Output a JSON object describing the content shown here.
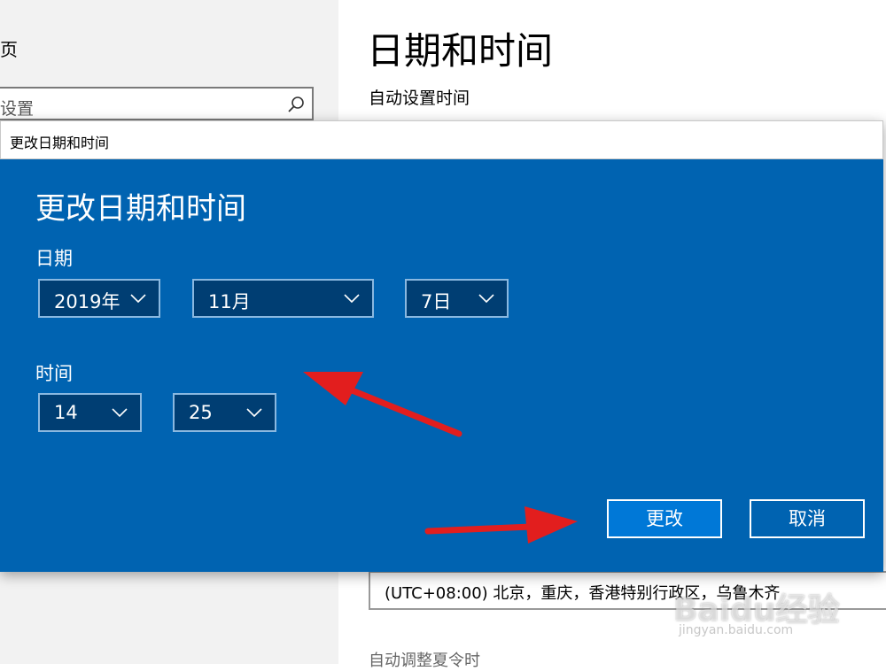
{
  "left": {
    "home_label": "主页",
    "search_placeholder": "查找设置"
  },
  "right": {
    "title": "日期和时间",
    "auto_time_label": "自动设置时间",
    "timezone_value": "(UTC+08:00) 北京，重庆，香港特别行政区，乌鲁木齐",
    "dst_label": "自动调整夏令时"
  },
  "dialog": {
    "window_title": "更改日期和时间",
    "heading": "更改日期和时间",
    "date_label": "日期",
    "year": "2019年",
    "month": "11月",
    "day": "7日",
    "time_label": "时间",
    "hour": "14",
    "minute": "25",
    "change_button": "更改",
    "cancel_button": "取消"
  },
  "colors": {
    "dialog_blue": "#0063b1",
    "select_bg": "#003e73",
    "primary_button": "#0078d7",
    "annotation_arrow": "#e21e1e"
  },
  "icons": [
    "search-icon",
    "chevron-down-icon"
  ],
  "watermark": {
    "brand": "Baidu经验",
    "url": "jingyan.baidu.com"
  }
}
